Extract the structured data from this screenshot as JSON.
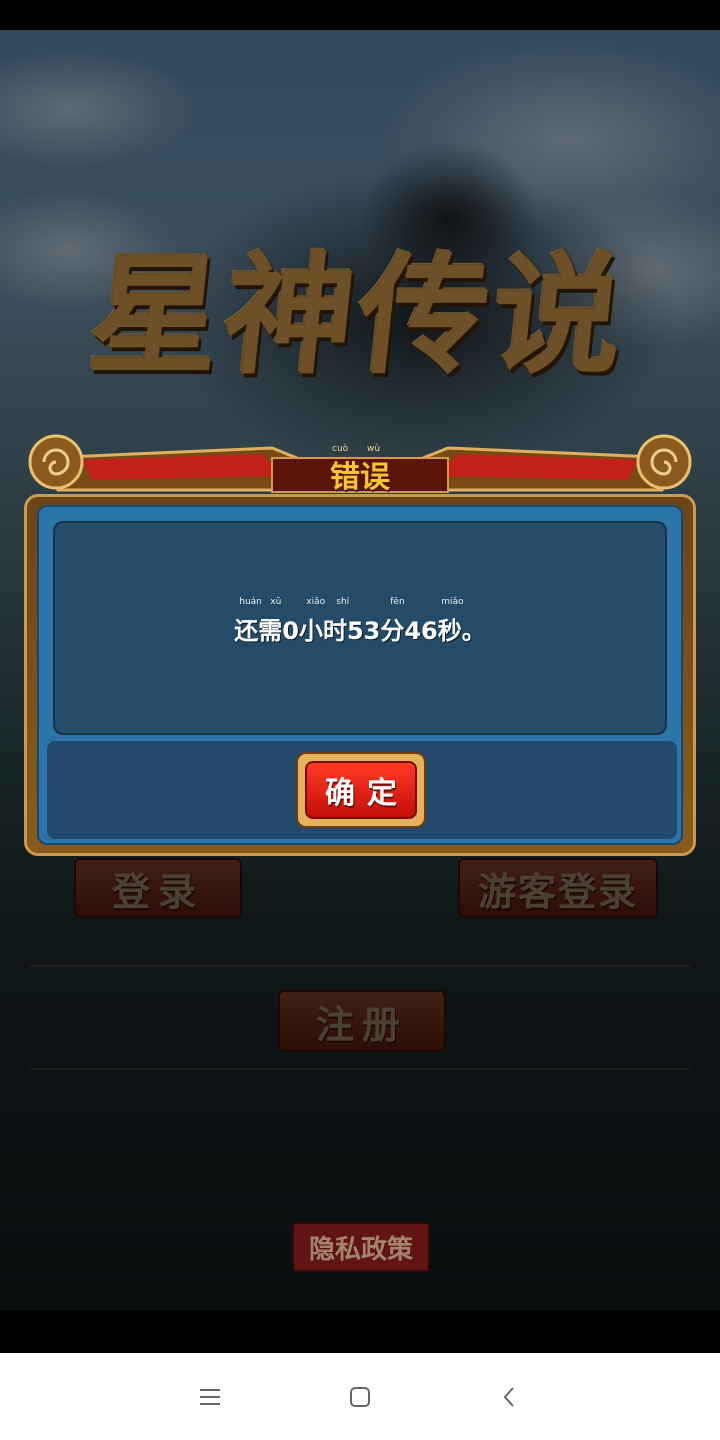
{
  "game": {
    "logo_text": "星神传说"
  },
  "dialog": {
    "title": "错误",
    "title_pinyin": [
      "cuò",
      "wù"
    ],
    "message": "还需0小时53分46秒。",
    "message_pinyin": [
      "huán",
      "xū",
      "xiǎo",
      "shí",
      "fēn",
      "miǎo"
    ],
    "confirm_label": "确定"
  },
  "background_buttons": {
    "login": "登录",
    "guest_login": "游客登录",
    "register": "注册",
    "privacy": "隐私政策"
  },
  "navigation": {
    "menu_icon": "menu-lines-icon",
    "home_icon": "square-home-icon",
    "back_icon": "chevron-left-icon"
  }
}
